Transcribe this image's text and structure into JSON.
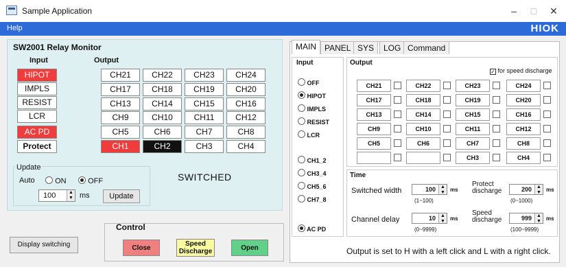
{
  "app": {
    "title": "Sample Application",
    "brand": "HIOK",
    "menu": [
      "Help"
    ]
  },
  "window": {
    "minimize": "–",
    "maximize": "□",
    "close": "✕"
  },
  "monitor": {
    "title": "SW2001 Relay Monitor",
    "input_header": "Input",
    "output_header": "Output",
    "inputs": [
      {
        "label": "HIPOT",
        "state": "active"
      },
      {
        "label": "IMPLS",
        "state": "normal"
      },
      {
        "label": "RESIST",
        "state": "normal"
      },
      {
        "label": "LCR",
        "state": "normal"
      },
      {
        "label": "AC PD",
        "state": "active"
      },
      {
        "label": "Protect",
        "state": "normal"
      }
    ],
    "outputs": [
      [
        "CH21",
        "CH22",
        "CH23",
        "CH24"
      ],
      [
        "CH17",
        "CH18",
        "CH19",
        "CH20"
      ],
      [
        "CH13",
        "CH14",
        "CH15",
        "CH16"
      ],
      [
        "CH9",
        "CH10",
        "CH11",
        "CH12"
      ],
      [
        "CH5",
        "CH6",
        "CH7",
        "CH8"
      ],
      [
        "CH1",
        "CH2",
        "CH3",
        "CH4"
      ]
    ],
    "output_states": {
      "CH1": "high",
      "CH2": "low"
    },
    "update": {
      "group_label": "Update",
      "auto_label": "Auto",
      "on_label": "ON",
      "off_label": "OFF",
      "selected": "OFF",
      "interval": "100",
      "unit": "ms",
      "button": "Update"
    },
    "status": "SWITCHED"
  },
  "bottom": {
    "display_switching": "Display switching",
    "control_label": "Control",
    "close": "Close",
    "speed_discharge": "Speed Discharge",
    "open": "Open"
  },
  "tabs": [
    {
      "label": "MAIN",
      "active": true
    },
    {
      "label": "PANEL",
      "active": false
    },
    {
      "label": "SYS",
      "active": false
    },
    {
      "label": "LOG",
      "active": false
    },
    {
      "label": "Command",
      "active": false
    }
  ],
  "main": {
    "input_header": "Input",
    "output_header": "Output",
    "speed_discharge_checkbox": "for speed discharge",
    "inputs": [
      "OFF",
      "HIPOT",
      "IMPLS",
      "RESIST",
      "LCR"
    ],
    "inputs_selected": "HIPOT",
    "ch_pairs": [
      "CH1_2",
      "CH3_4",
      "CH5_6",
      "CH7_8"
    ],
    "ac_pd": "AC PD",
    "outputs": [
      [
        "CH21",
        "CH22",
        "CH23",
        "CH24"
      ],
      [
        "CH17",
        "CH18",
        "CH19",
        "CH20"
      ],
      [
        "CH13",
        "CH14",
        "CH15",
        "CH16"
      ],
      [
        "CH9",
        "CH10",
        "CH11",
        "CH12"
      ],
      [
        "CH5",
        "CH6",
        "CH7",
        "CH8"
      ],
      [
        "CH1",
        "CH2",
        "CH3",
        "CH4"
      ]
    ],
    "time": {
      "label": "Time",
      "switched_width": {
        "label": "Switched width",
        "value": "100",
        "unit": "ms",
        "range": "(1~100)"
      },
      "protect_discharge": {
        "label": "Protect discharge",
        "value": "200",
        "unit": "ms",
        "range": "(0~1000)"
      },
      "channel_delay": {
        "label": "Channel delay",
        "value": "10",
        "unit": "ms",
        "range": "(0~9999)"
      },
      "speed_discharge": {
        "label": "Speed discharge",
        "value": "999",
        "unit": "ms",
        "range": "(100~9999)"
      }
    },
    "hint": "Output is set to H with a left click and L with a right click."
  },
  "colors": {
    "titlebar_blue": "#2c6bd8",
    "active_red": "#f03c3c",
    "low_black": "#111111",
    "monitor_bg": "#dff0f3",
    "close_btn": "#f08080",
    "speed_btn": "#fafaa0",
    "open_btn": "#62d088"
  }
}
